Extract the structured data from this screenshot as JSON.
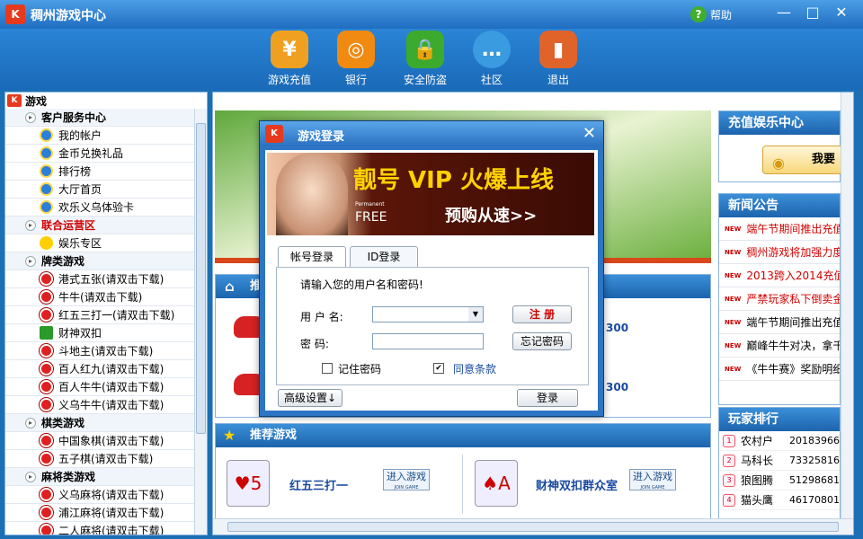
{
  "window": {
    "title": "稠州游戏中心",
    "help": "帮助",
    "controls": {
      "minimize": "—",
      "maximize": "□",
      "close": "✕"
    }
  },
  "toolbar": [
    {
      "label": "游戏充值",
      "icon": "money-bag-icon",
      "color": "#f0a020"
    },
    {
      "label": "银行",
      "icon": "safe-icon",
      "color": "#f08a10"
    },
    {
      "label": "安全防盗",
      "icon": "lock-icon",
      "color": "#3caa2c"
    },
    {
      "label": "社区",
      "icon": "chat-bubble-icon",
      "color": "#3a9be0"
    },
    {
      "label": "退出",
      "icon": "exit-door-icon",
      "color": "#e0632a"
    }
  ],
  "sidebar": {
    "root": "游戏",
    "items": [
      {
        "type": "cat",
        "label": "客户服务中心"
      },
      {
        "type": "item",
        "label": "我的帐户",
        "icon": "ie-icon"
      },
      {
        "type": "item",
        "label": "金币兑换礼品",
        "icon": "ie-icon"
      },
      {
        "type": "item",
        "label": "排行榜",
        "icon": "ie-icon"
      },
      {
        "type": "item",
        "label": "大厅首页",
        "icon": "ie-icon"
      },
      {
        "type": "item",
        "label": "欢乐义乌体验卡",
        "icon": "ie-icon"
      },
      {
        "type": "cat",
        "label": "联合运营区",
        "red": true
      },
      {
        "type": "item",
        "label": "娱乐专区",
        "icon": "sun-icon"
      },
      {
        "type": "cat",
        "label": "牌类游戏"
      },
      {
        "type": "item",
        "label": "港式五张(请双击下载)",
        "icon": "no-entry-icon"
      },
      {
        "type": "item",
        "label": "牛牛(请双击下载)",
        "icon": "no-entry-icon"
      },
      {
        "type": "item",
        "label": "红五三打一(请双击下载)",
        "icon": "no-entry-icon"
      },
      {
        "type": "item",
        "label": "财神双扣",
        "icon": "double-icon"
      },
      {
        "type": "item",
        "label": "斗地主(请双击下载)",
        "icon": "no-entry-icon"
      },
      {
        "type": "item",
        "label": "百人红九(请双击下载)",
        "icon": "no-entry-icon"
      },
      {
        "type": "item",
        "label": "百人牛牛(请双击下载)",
        "icon": "no-entry-icon"
      },
      {
        "type": "item",
        "label": "义乌牛牛(请双击下载)",
        "icon": "no-entry-icon"
      },
      {
        "type": "cat",
        "label": "棋类游戏"
      },
      {
        "type": "item",
        "label": "中国象棋(请双击下载)",
        "icon": "no-entry-icon"
      },
      {
        "type": "item",
        "label": "五子棋(请双击下载)",
        "icon": "no-entry-icon"
      },
      {
        "type": "cat",
        "label": "麻将类游戏"
      },
      {
        "type": "item",
        "label": "义乌麻将(请双击下载)",
        "icon": "no-entry-icon"
      },
      {
        "type": "item",
        "label": "浦江麻将(请双击下载)",
        "icon": "no-entry-icon"
      },
      {
        "type": "item",
        "label": "二人麻将(请双击下载)",
        "icon": "no-entry-icon"
      }
    ]
  },
  "main": {
    "rec_header_partial": "推",
    "rec_numbers": [
      "300",
      "300"
    ],
    "recommend_title": "推荐游戏",
    "games": [
      {
        "name": "红五三打一",
        "join": "进入游戏",
        "join_en": "JOIN GAME"
      },
      {
        "name": "财神双扣群众室",
        "join": "进入游戏",
        "join_en": "JOIN GAME"
      }
    ],
    "recharge": {
      "title": "充值娱乐中心",
      "button": "我要"
    },
    "news": {
      "title": "新闻公告",
      "items": [
        {
          "text": "端午节期间推出充值",
          "color": "#d10000"
        },
        {
          "text": "稠州游戏将加强力度",
          "color": "#d10000"
        },
        {
          "text": "2013跨入2014充值返",
          "color": "#d10000"
        },
        {
          "text": "严禁玩家私下倒卖金",
          "color": "#d10000"
        },
        {
          "text": "端午节期间推出充值",
          "color": "#000000"
        },
        {
          "text": "巅峰牛牛对决，拿千",
          "color": "#000000"
        },
        {
          "text": "《牛牛赛》奖励明细",
          "color": "#000000"
        }
      ]
    },
    "ranking": {
      "title": "玩家排行",
      "items": [
        {
          "rank": "1",
          "name": "农村户",
          "score": "20183966"
        },
        {
          "rank": "2",
          "name": "马科长",
          "score": "73325816"
        },
        {
          "rank": "3",
          "name": "狼图腾",
          "score": "51298681"
        },
        {
          "rank": "4",
          "name": "猫头鹰",
          "score": "46170801"
        }
      ]
    }
  },
  "dialog": {
    "title": "游戏登录",
    "banner": {
      "line1": "靓号 VIP 火爆上线",
      "line2": "预购从速>>",
      "line3": "FREE",
      "line4": "Permanent"
    },
    "tabs": [
      "帐号登录",
      "ID登录"
    ],
    "prompt": "请输入您的用户名和密码!",
    "username_label": "用 户 名:",
    "password_label": "密    码:",
    "register": "注 册",
    "forgot": "忘记密码",
    "remember": "记住密码",
    "agree": "同意条款",
    "advanced": "高级设置↓",
    "login": "登录"
  }
}
